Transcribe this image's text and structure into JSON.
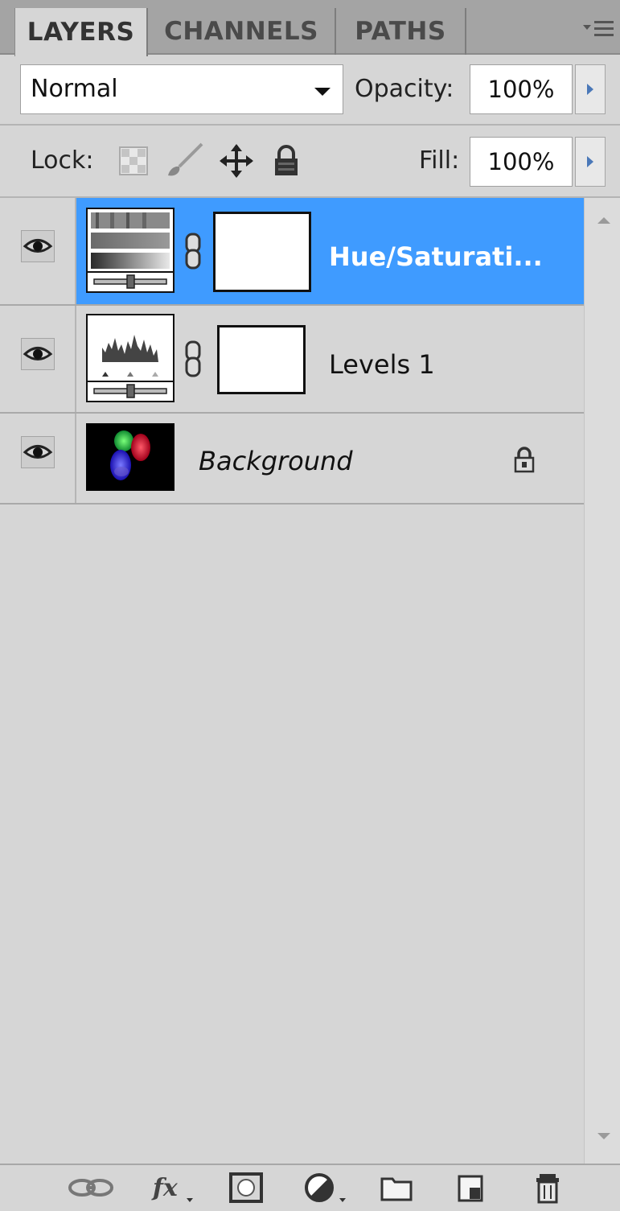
{
  "tabs": [
    {
      "label": "LAYERS",
      "active": true
    },
    {
      "label": "CHANNELS",
      "active": false
    },
    {
      "label": "PATHS",
      "active": false
    }
  ],
  "blend": {
    "mode": "Normal"
  },
  "opacity": {
    "label": "Opacity:",
    "value": "100%"
  },
  "lock": {
    "label": "Lock:",
    "icons": [
      "lock-transparent-pixels-icon",
      "lock-image-pixels-icon",
      "lock-position-icon",
      "lock-all-icon"
    ]
  },
  "fill": {
    "label": "Fill:",
    "value": "100%"
  },
  "layers": [
    {
      "name": "Hue/Saturati...",
      "type": "adjustment-hue-saturation",
      "visible": true,
      "selected": true
    },
    {
      "name": "Levels 1",
      "type": "adjustment-levels",
      "visible": true,
      "selected": false
    },
    {
      "name": "Background",
      "type": "pixel",
      "visible": true,
      "selected": false,
      "locked": true
    }
  ],
  "bottom_icons": [
    "link-layers-icon",
    "layer-style-fx-icon",
    "add-mask-icon",
    "adjustment-layer-icon",
    "new-group-icon",
    "new-layer-icon",
    "delete-layer-icon"
  ],
  "colors": {
    "selection": "#3f9bff",
    "panel": "#d6d6d6",
    "tab_inactive": "#a4a4a4"
  }
}
